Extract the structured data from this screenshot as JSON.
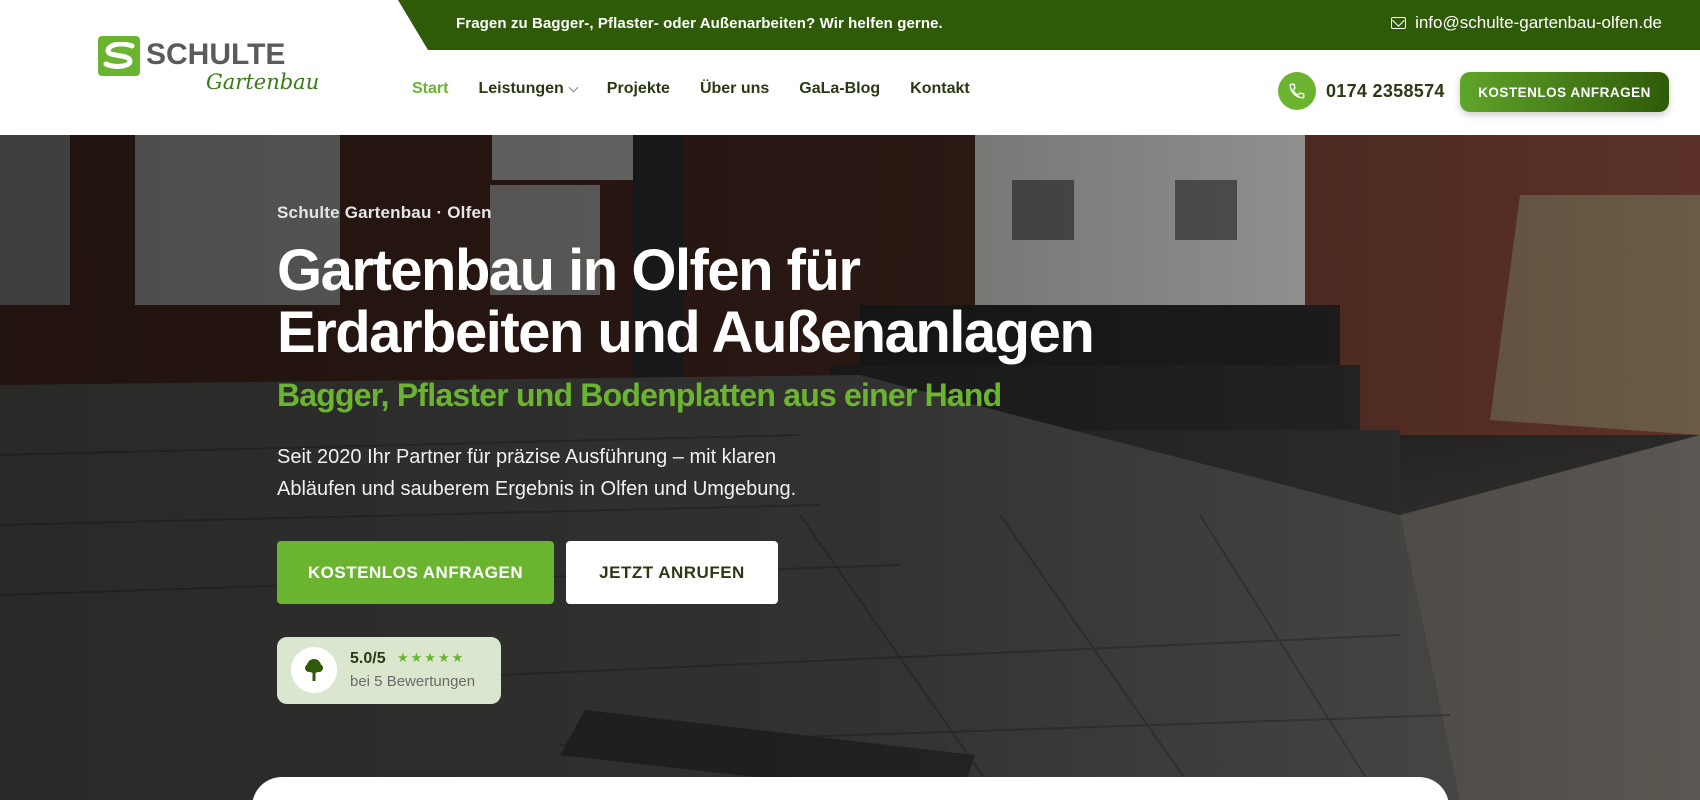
{
  "topbar": {
    "message": "Fragen zu Bagger-, Pflaster- oder Außenarbeiten? Wir helfen gerne.",
    "email": "info@schulte-gartenbau-olfen.de"
  },
  "logo": {
    "word": "SCHULTE",
    "sub": "Gartenbau"
  },
  "nav": [
    {
      "label": "Start",
      "active": true
    },
    {
      "label": "Leistungen",
      "has_dropdown": true
    },
    {
      "label": "Projekte"
    },
    {
      "label": "Über uns"
    },
    {
      "label": "GaLa-Blog"
    },
    {
      "label": "Kontakt"
    }
  ],
  "header": {
    "phone": "0174 2358574",
    "cta": "KOSTENLOS ANFRAGEN"
  },
  "hero": {
    "kicker": "Schulte Gartenbau · Olfen",
    "title_line1": "Gartenbau in Olfen für",
    "title_line2": "Erdarbeiten und Außenanlagen",
    "subtitle": "Bagger, Pflaster und Bodenplatten aus einer Hand",
    "lead_line1": "Seit 2020 Ihr Partner für präzise Ausführung – mit klaren",
    "lead_line2": "Abläufen und sauberem Ergebnis in Olfen und Umgebung.",
    "btn_primary": "KOSTENLOS ANFRAGEN",
    "btn_secondary": "JETZT ANRUFEN"
  },
  "rating": {
    "score": "5.0/5",
    "stars": "★★★★★",
    "sub": "bei 5 Bewertungen",
    "value": 5.0,
    "max": 5
  },
  "colors": {
    "brand_green": "#6ab42f",
    "dark_green": "#2f5a08",
    "text_dark": "#2b3a14"
  }
}
